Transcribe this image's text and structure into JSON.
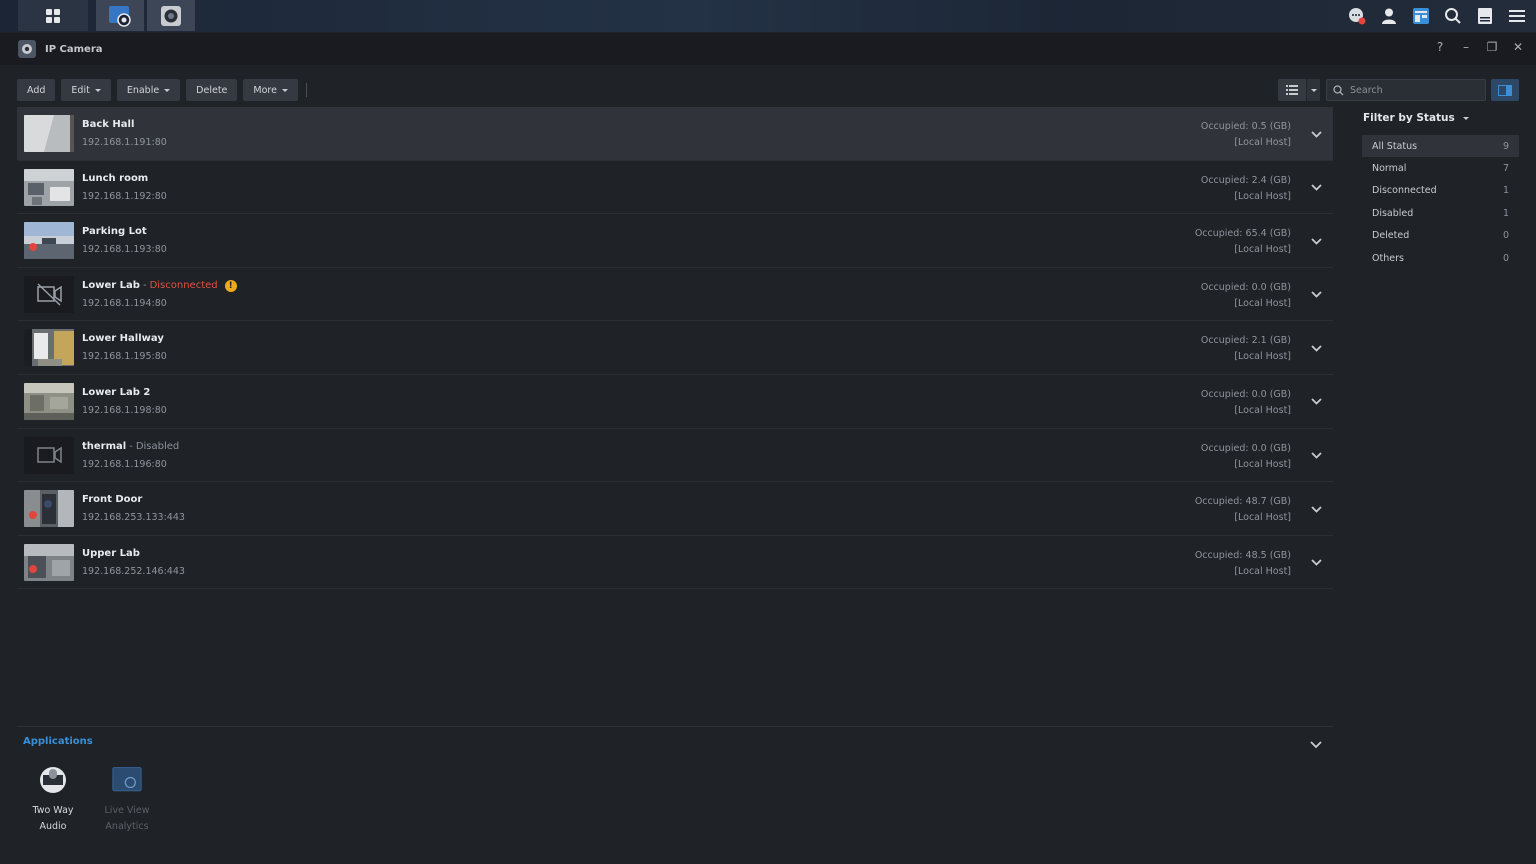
{
  "window": {
    "title": "IP Camera"
  },
  "toolbar": {
    "add": "Add",
    "edit": "Edit",
    "enable": "Enable",
    "delete": "Delete",
    "more": "More"
  },
  "search": {
    "placeholder": "Search"
  },
  "cameras": [
    {
      "name": "Back Hall",
      "status": "",
      "ip": "192.168.1.191:80",
      "occupied": "Occupied: 0.5 (GB)",
      "host": "[Local Host]",
      "recording": false,
      "thumb": "light"
    },
    {
      "name": "Lunch room",
      "status": "",
      "ip": "192.168.1.192:80",
      "occupied": "Occupied: 2.4 (GB)",
      "host": "[Local Host]",
      "recording": false,
      "thumb": "room"
    },
    {
      "name": "Parking Lot",
      "status": "",
      "ip": "192.168.1.193:80",
      "occupied": "Occupied: 65.4 (GB)",
      "host": "[Local Host]",
      "recording": true,
      "thumb": "outdoor"
    },
    {
      "name": "Lower Lab",
      "status": "Disconnected",
      "ip": "192.168.1.194:80",
      "occupied": "Occupied: 0.0 (GB)",
      "host": "[Local Host]",
      "recording": false,
      "thumb": "disconnected"
    },
    {
      "name": "Lower Hallway",
      "status": "",
      "ip": "192.168.1.195:80",
      "occupied": "Occupied: 2.1 (GB)",
      "host": "[Local Host]",
      "recording": false,
      "thumb": "hallway"
    },
    {
      "name": "Lower Lab 2",
      "status": "",
      "ip": "192.168.1.198:80",
      "occupied": "Occupied: 0.0 (GB)",
      "host": "[Local Host]",
      "recording": false,
      "thumb": "lab"
    },
    {
      "name": "thermal",
      "status": "Disabled",
      "ip": "192.168.1.196:80",
      "occupied": "Occupied: 0.0 (GB)",
      "host": "[Local Host]",
      "recording": false,
      "thumb": "disabled"
    },
    {
      "name": "Front Door",
      "status": "",
      "ip": "192.168.253.133:443",
      "occupied": "Occupied: 48.7 (GB)",
      "host": "[Local Host]",
      "recording": true,
      "thumb": "door"
    },
    {
      "name": "Upper Lab",
      "status": "",
      "ip": "192.168.252.146:443",
      "occupied": "Occupied: 48.5 (GB)",
      "host": "[Local Host]",
      "recording": true,
      "thumb": "upper"
    }
  ],
  "filter": {
    "title": "Filter by Status",
    "items": [
      {
        "label": "All Status",
        "count": "9"
      },
      {
        "label": "Normal",
        "count": "7"
      },
      {
        "label": "Disconnected",
        "count": "1"
      },
      {
        "label": "Disabled",
        "count": "1"
      },
      {
        "label": "Deleted",
        "count": "0"
      },
      {
        "label": "Others",
        "count": "0"
      }
    ]
  },
  "applications": {
    "title": "Applications",
    "items": [
      {
        "label_line1": "Two Way",
        "label_line2": "Audio"
      },
      {
        "label_line1": "Live View",
        "label_line2": "Analytics"
      }
    ]
  },
  "colors": {
    "accent": "#3a8fd6",
    "disconnected": "#e0523f",
    "warning": "#f0a81c",
    "recording": "#e2453c"
  }
}
